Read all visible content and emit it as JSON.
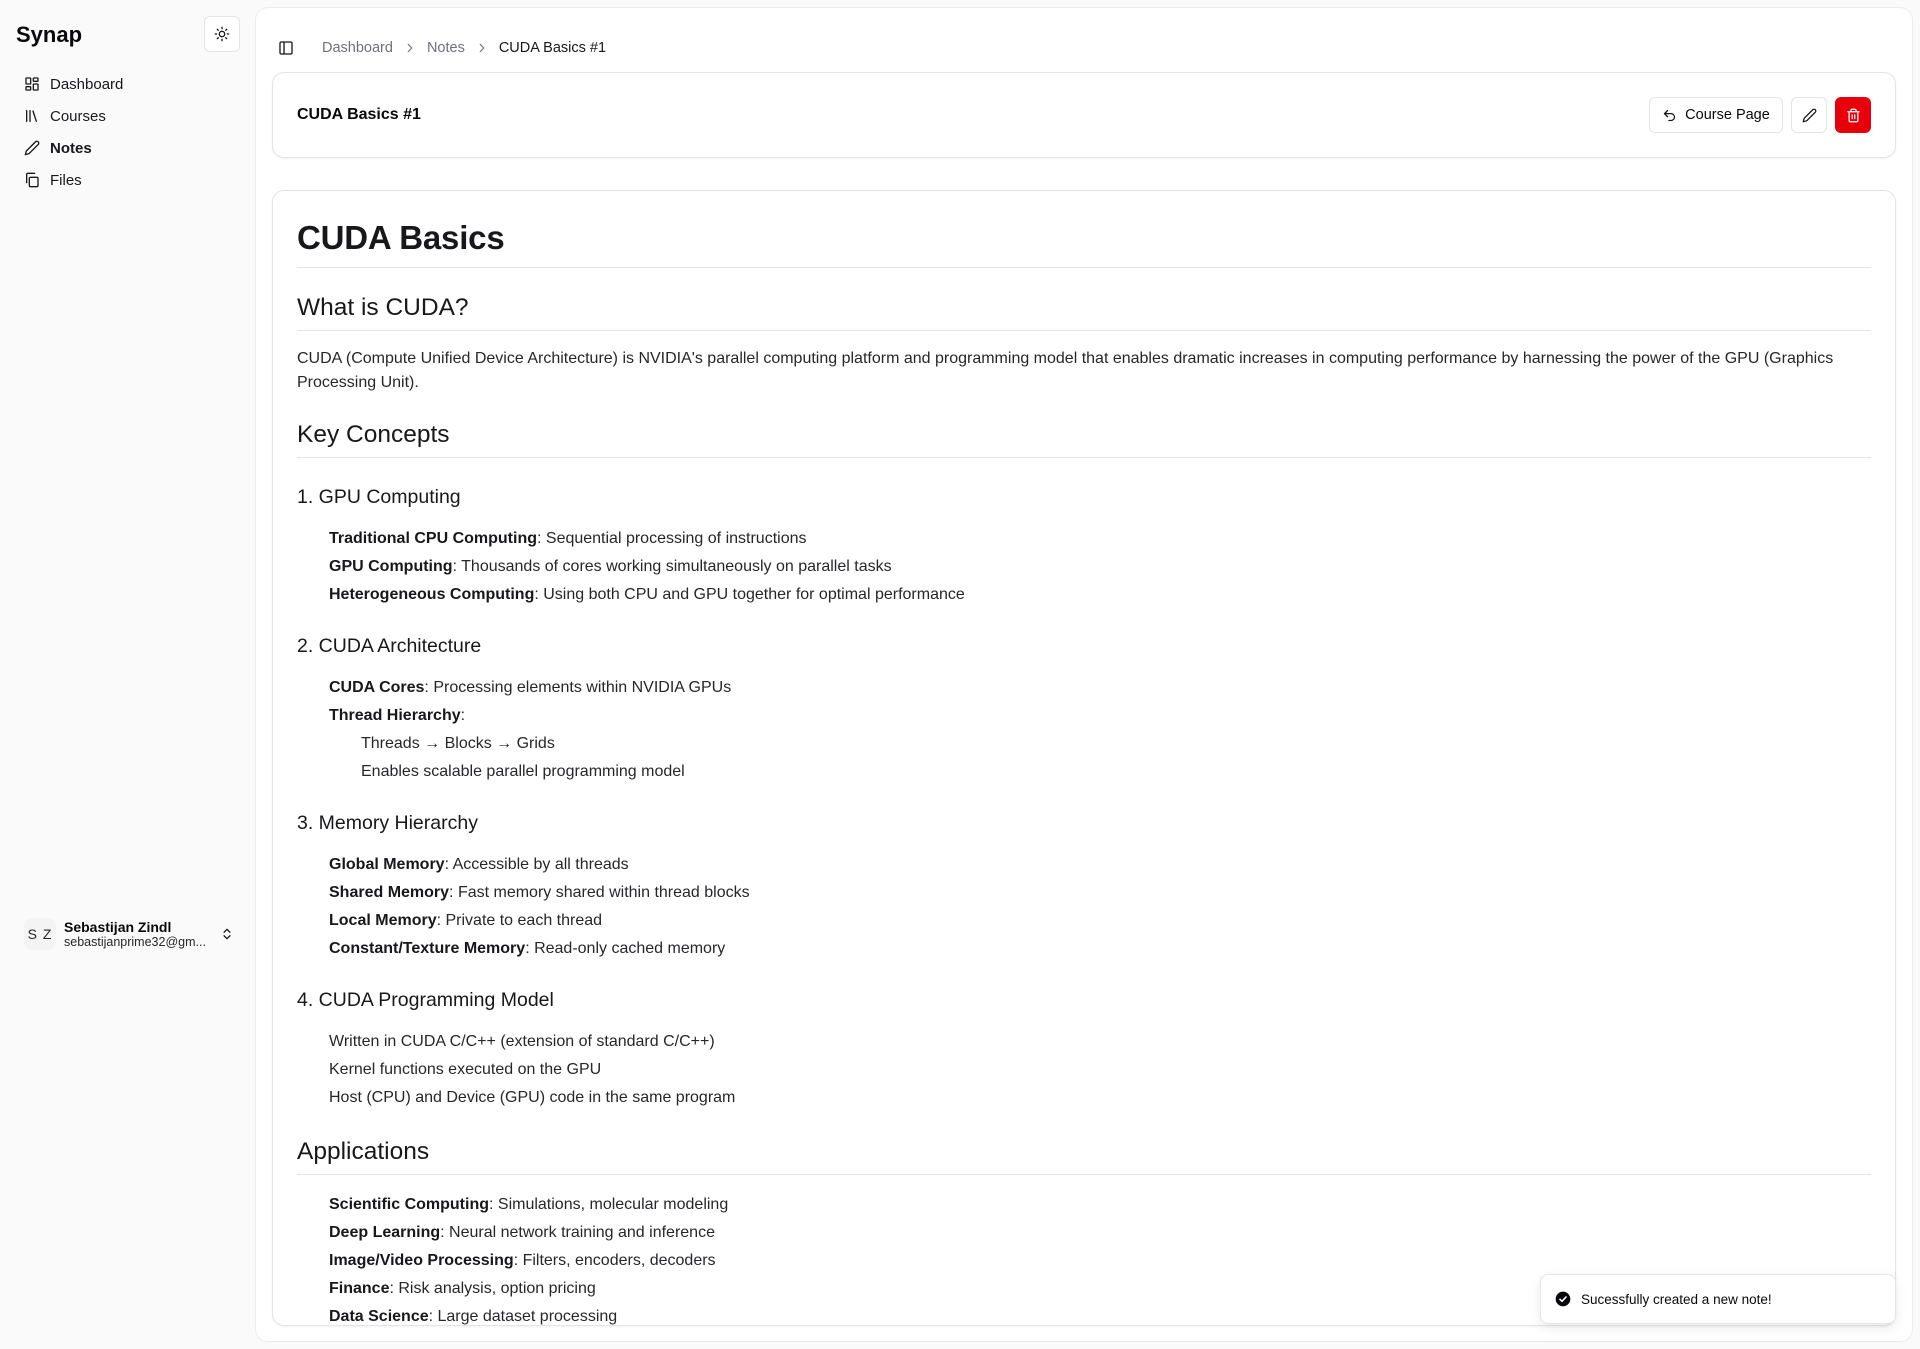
{
  "sidebar": {
    "brand": "Synap",
    "theme_icon": "sun-icon",
    "items": [
      {
        "label": "Dashboard",
        "icon": "layout-dashboard-icon",
        "active": false
      },
      {
        "label": "Courses",
        "icon": "library-icon",
        "active": false
      },
      {
        "label": "Notes",
        "icon": "pencil-icon",
        "active": true
      },
      {
        "label": "Files",
        "icon": "files-icon",
        "active": false
      }
    ],
    "user": {
      "initials": "S Z",
      "name": "Sebastijan Zindl",
      "email": "sebastijanprime32@gm..."
    }
  },
  "breadcrumb": [
    "Dashboard",
    "Notes",
    "CUDA Basics #1"
  ],
  "header": {
    "title": "CUDA Basics #1",
    "course_button": "Course Page",
    "edit_icon": "pencil-icon",
    "delete_icon": "trash-icon",
    "danger_color": "#e7000b"
  },
  "note": {
    "h1": "CUDA Basics",
    "what_heading": "What is CUDA?",
    "what_text": "CUDA (Compute Unified Device Architecture) is NVIDIA's parallel computing platform and programming model that enables dramatic increases in computing performance by harnessing the power of the GPU (Graphics Processing Unit).",
    "key_heading": "Key Concepts",
    "gpu": {
      "heading": "1. GPU Computing",
      "items": [
        {
          "term": "Traditional CPU Computing",
          "desc": ": Sequential processing of instructions"
        },
        {
          "term": "GPU Computing",
          "desc": ": Thousands of cores working simultaneously on parallel tasks"
        },
        {
          "term": "Heterogeneous Computing",
          "desc": ": Using both CPU and GPU together for optimal performance"
        }
      ]
    },
    "arch": {
      "heading": "2. CUDA Architecture",
      "items": [
        {
          "term": "CUDA Cores",
          "desc": ": Processing elements within NVIDIA GPUs"
        },
        {
          "term": "Thread Hierarchy",
          "desc": ":"
        }
      ],
      "sub": [
        "Threads → Blocks → Grids",
        "Enables scalable parallel programming model"
      ]
    },
    "mem": {
      "heading": "3. Memory Hierarchy",
      "items": [
        {
          "term": "Global Memory",
          "desc": ": Accessible by all threads"
        },
        {
          "term": "Shared Memory",
          "desc": ": Fast memory shared within thread blocks"
        },
        {
          "term": "Local Memory",
          "desc": ": Private to each thread"
        },
        {
          "term": "Constant/Texture Memory",
          "desc": ": Read-only cached memory"
        }
      ]
    },
    "model": {
      "heading": "4. CUDA Programming Model",
      "items": [
        "Written in CUDA C/C++ (extension of standard C/C++)",
        "Kernel functions executed on the GPU",
        "Host (CPU) and Device (GPU) code in the same program"
      ]
    },
    "apps": {
      "heading": "Applications",
      "items": [
        {
          "term": "Scientific Computing",
          "desc": ": Simulations, molecular modeling"
        },
        {
          "term": "Deep Learning",
          "desc": ": Neural network training and inference"
        },
        {
          "term": "Image/Video Processing",
          "desc": ": Filters, encoders, decoders"
        },
        {
          "term": "Finance",
          "desc": ": Risk analysis, option pricing"
        },
        {
          "term": "Data Science",
          "desc": ": Large dataset processing"
        }
      ]
    }
  },
  "toast": {
    "icon": "check-circle-icon",
    "message": "Sucessfully created a new note!"
  }
}
